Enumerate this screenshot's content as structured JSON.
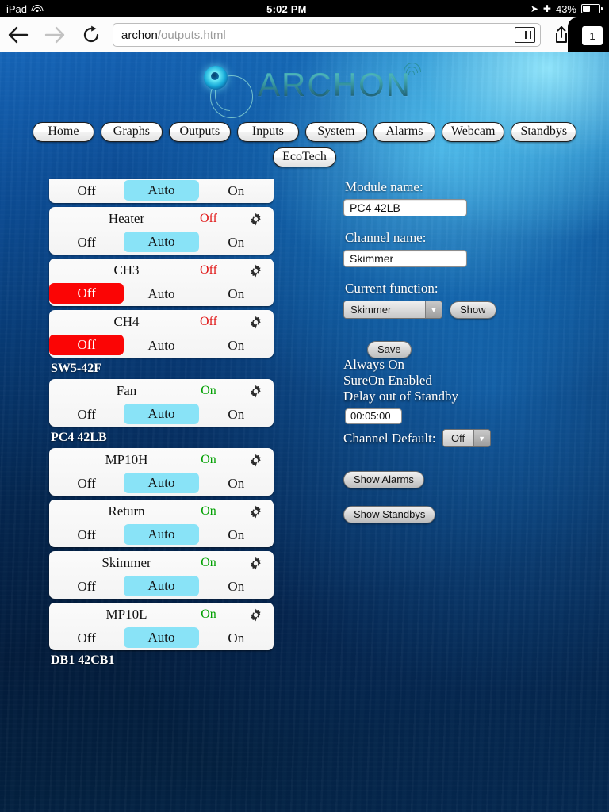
{
  "status_bar": {
    "carrier": "iPad",
    "wifi_icon": "wifi-icon",
    "time": "5:02 PM",
    "location_icon": "location-arrow-icon",
    "bluetooth_icon": "bluetooth-icon",
    "battery_text": "43%",
    "battery_icon": "battery-icon"
  },
  "browser": {
    "back_icon": "back-arrow-icon",
    "forward_icon": "forward-arrow-icon",
    "reload_icon": "reload-icon",
    "url_bold": "archon",
    "url_rest": "/outputs.html",
    "url_full": "archon/outputs.html",
    "reader_icon": "reader-view-icon",
    "share_icon": "share-icon",
    "bookmark_icon": "bookmark-star-icon",
    "tab_count": "1"
  },
  "site": {
    "logo_text": "ARCHON",
    "logo_mark": "archon-logo-mark",
    "signal_icon": "signal-waves-icon"
  },
  "nav": {
    "row1": [
      "Home",
      "Graphs",
      "Outputs",
      "Inputs",
      "System",
      "Alarms",
      "Webcam",
      "Standbys"
    ],
    "row2": [
      "EcoTech"
    ]
  },
  "outputs": {
    "segment_labels": {
      "off": "Off",
      "auto": "Auto",
      "on": "On"
    },
    "gear_icon": "gear-icon",
    "blocks": [
      {
        "header": null,
        "header_clipped": false,
        "cards": [
          {
            "name": null,
            "clipped_top": true,
            "state": null,
            "state_class": "",
            "selected": "auto"
          },
          {
            "name": "Heater",
            "clipped_top": false,
            "state": "Off",
            "state_class": "off",
            "selected": "auto"
          },
          {
            "name": "CH3",
            "clipped_top": false,
            "state": "Off",
            "state_class": "off",
            "selected": "off"
          },
          {
            "name": "CH4",
            "clipped_top": false,
            "state": "Off",
            "state_class": "off",
            "selected": "off"
          }
        ]
      },
      {
        "header": "SW5-42F",
        "header_clipped": false,
        "cards": [
          {
            "name": "Fan",
            "clipped_top": false,
            "state": "On",
            "state_class": "on",
            "selected": "auto"
          }
        ]
      },
      {
        "header": "PC4 42LB",
        "header_clipped": false,
        "cards": [
          {
            "name": "MP10H",
            "clipped_top": false,
            "state": "On",
            "state_class": "on",
            "selected": "auto"
          },
          {
            "name": "Return",
            "clipped_top": false,
            "state": "On",
            "state_class": "on",
            "selected": "auto"
          },
          {
            "name": "Skimmer",
            "clipped_top": false,
            "state": "On",
            "state_class": "on",
            "selected": "auto"
          },
          {
            "name": "MP10L",
            "clipped_top": false,
            "state": "On",
            "state_class": "on",
            "selected": "auto"
          }
        ]
      },
      {
        "header": "DB1 42CB1",
        "header_clipped": true,
        "cards": []
      }
    ]
  },
  "detail": {
    "module_name_label": "Module name:",
    "module_name_value": "PC4 42LB",
    "channel_name_label": "Channel name:",
    "channel_name_value": "Skimmer",
    "current_function_label": "Current function:",
    "current_function_value": "Skimmer",
    "show_button": "Show",
    "save_button": "Save",
    "always_on": "Always On",
    "sureon": "SureOn Enabled",
    "delay_label": "Delay out of Standby",
    "delay_value": "00:05:00",
    "channel_default_label": "Channel Default:",
    "channel_default_value": "Off",
    "show_alarms_button": "Show Alarms",
    "show_standbys_button": "Show Standbys",
    "dropdown_icon": "chevron-down-icon"
  },
  "colors": {
    "auto_selected": "#89e3f7",
    "off_selected": "#fb0505",
    "state_on": "#00a000",
    "state_off": "#e01515",
    "logo_teal": "#2d8f96"
  }
}
